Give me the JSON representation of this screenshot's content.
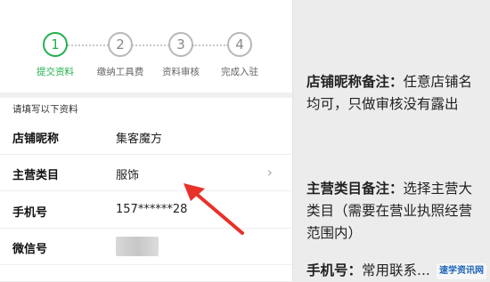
{
  "steps": [
    {
      "num": "1",
      "label": "提交资料",
      "active": true
    },
    {
      "num": "2",
      "label": "缴纳工具费",
      "active": false
    },
    {
      "num": "3",
      "label": "资料审核",
      "active": false
    },
    {
      "num": "4",
      "label": "完成入驻",
      "active": false
    }
  ],
  "form": {
    "hint": "请填写以下资料",
    "rows": [
      {
        "label": "店铺昵称",
        "value": "集客魔方"
      },
      {
        "label": "主营类目",
        "value": "服饰"
      },
      {
        "label": "手机号",
        "value": "157******28"
      },
      {
        "label": "微信号",
        "value": ""
      }
    ],
    "chevron": "›"
  },
  "notes": [
    {
      "title": "店铺昵称备注：",
      "body": "任意店铺名均可，只做审核没有露出"
    },
    {
      "title": "主营类目备注：",
      "body": "选择主营大类目（需要在营业执照经营范围内）"
    },
    {
      "title": "手机号：",
      "body": "常用联系..."
    }
  ],
  "watermark": "速学资讯网",
  "colors": {
    "accent": "#22b14c",
    "arrow": "#e8312a"
  }
}
